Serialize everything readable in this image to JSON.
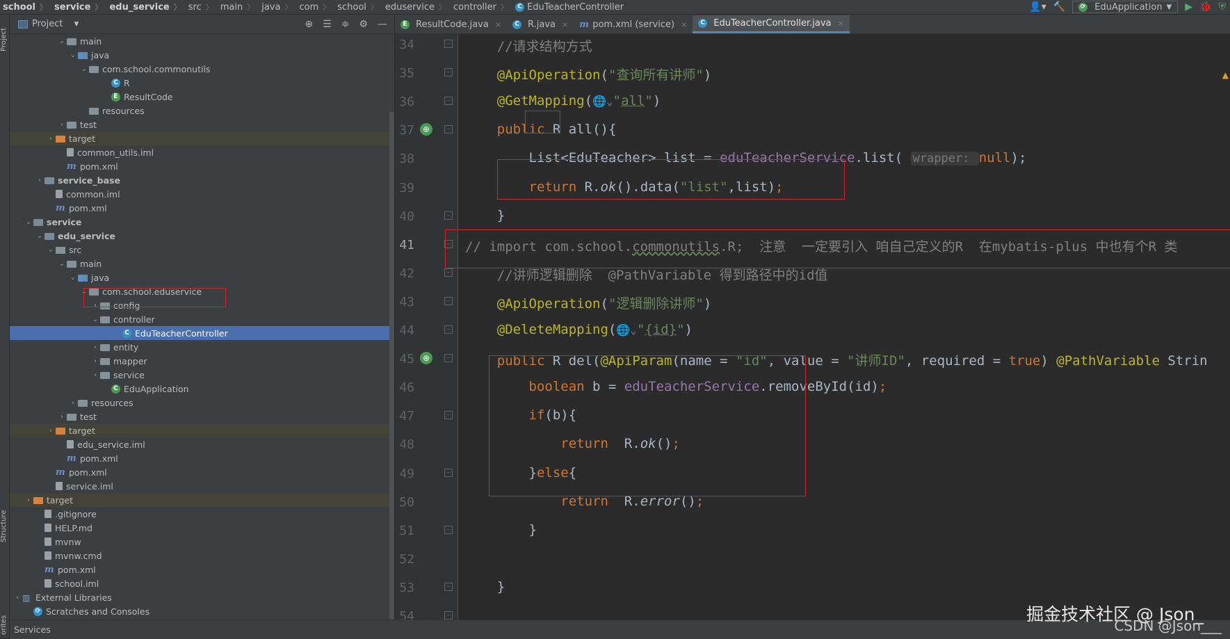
{
  "breadcrumb": [
    {
      "label": "school",
      "bold": true
    },
    {
      "label": "service",
      "bold": true
    },
    {
      "label": "edu_service",
      "bold": true
    },
    {
      "label": "src",
      "bold": false
    },
    {
      "label": "main",
      "bold": false
    },
    {
      "label": "java",
      "bold": false
    },
    {
      "label": "com",
      "bold": false
    },
    {
      "label": "school",
      "bold": false
    },
    {
      "label": "eduservice",
      "bold": false
    },
    {
      "label": "controller",
      "bold": false
    }
  ],
  "breadcrumb_current": "EduTeacherController",
  "run_config": "EduApplication",
  "left_tabs": {
    "project": "Project",
    "structure": "Structure",
    "favorites": "orites"
  },
  "project_panel": {
    "title": "Project"
  },
  "tree": [
    {
      "label": "main",
      "indent": 4,
      "icon": "folder",
      "arrow": "down"
    },
    {
      "label": "java",
      "indent": 5,
      "icon": "folder-blue",
      "arrow": "down"
    },
    {
      "label": "com.school.commonutils",
      "indent": 6,
      "icon": "package",
      "arrow": "down"
    },
    {
      "label": "R",
      "indent": 8,
      "icon": "class",
      "arrow": ""
    },
    {
      "label": "ResultCode",
      "indent": 8,
      "icon": "enum",
      "arrow": ""
    },
    {
      "label": "resources",
      "indent": 6,
      "icon": "folder-res",
      "arrow": ""
    },
    {
      "label": "test",
      "indent": 4,
      "icon": "folder",
      "arrow": "right"
    },
    {
      "label": "target",
      "indent": 3,
      "icon": "folder-orange",
      "arrow": "right",
      "highlight": "target"
    },
    {
      "label": "common_utils.iml",
      "indent": 4,
      "icon": "file",
      "arrow": ""
    },
    {
      "label": "pom.xml",
      "indent": 4,
      "icon": "maven",
      "arrow": ""
    },
    {
      "label": "service_base",
      "indent": 2,
      "icon": "module",
      "arrow": "right",
      "bold": true
    },
    {
      "label": "common.iml",
      "indent": 3,
      "icon": "file",
      "arrow": ""
    },
    {
      "label": "pom.xml",
      "indent": 3,
      "icon": "maven",
      "arrow": ""
    },
    {
      "label": "service",
      "indent": 1,
      "icon": "module",
      "arrow": "down",
      "bold": true
    },
    {
      "label": "edu_service",
      "indent": 2,
      "icon": "module",
      "arrow": "down",
      "bold": true
    },
    {
      "label": "src",
      "indent": 3,
      "icon": "folder",
      "arrow": "down"
    },
    {
      "label": "main",
      "indent": 4,
      "icon": "folder",
      "arrow": "down"
    },
    {
      "label": "java",
      "indent": 5,
      "icon": "folder-blue",
      "arrow": "down"
    },
    {
      "label": "com.school.eduservice",
      "indent": 6,
      "icon": "package",
      "arrow": "down"
    },
    {
      "label": "config",
      "indent": 7,
      "icon": "package",
      "arrow": "right"
    },
    {
      "label": "controller",
      "indent": 7,
      "icon": "package",
      "arrow": "down"
    },
    {
      "label": "EduTeacherController",
      "indent": 9,
      "icon": "class",
      "arrow": "",
      "highlight": "selected"
    },
    {
      "label": "entity",
      "indent": 7,
      "icon": "package",
      "arrow": "right"
    },
    {
      "label": "mapper",
      "indent": 7,
      "icon": "package",
      "arrow": "right"
    },
    {
      "label": "service",
      "indent": 7,
      "icon": "package",
      "arrow": "right"
    },
    {
      "label": "EduApplication",
      "indent": 8,
      "icon": "spring",
      "arrow": ""
    },
    {
      "label": "resources",
      "indent": 5,
      "icon": "folder-res",
      "arrow": "right"
    },
    {
      "label": "test",
      "indent": 4,
      "icon": "folder",
      "arrow": "right"
    },
    {
      "label": "target",
      "indent": 3,
      "icon": "folder-orange",
      "arrow": "right",
      "highlight": "target"
    },
    {
      "label": "edu_service.iml",
      "indent": 4,
      "icon": "file",
      "arrow": ""
    },
    {
      "label": "pom.xml",
      "indent": 4,
      "icon": "maven",
      "arrow": ""
    },
    {
      "label": "pom.xml",
      "indent": 3,
      "icon": "maven",
      "arrow": ""
    },
    {
      "label": "service.iml",
      "indent": 3,
      "icon": "file",
      "arrow": ""
    },
    {
      "label": "target",
      "indent": 1,
      "icon": "folder-orange",
      "arrow": "right",
      "highlight": "target"
    },
    {
      "label": ".gitignore",
      "indent": 2,
      "icon": "file",
      "arrow": ""
    },
    {
      "label": "HELP.md",
      "indent": 2,
      "icon": "file",
      "arrow": ""
    },
    {
      "label": "mvnw",
      "indent": 2,
      "icon": "file",
      "arrow": ""
    },
    {
      "label": "mvnw.cmd",
      "indent": 2,
      "icon": "file",
      "arrow": ""
    },
    {
      "label": "pom.xml",
      "indent": 2,
      "icon": "maven",
      "arrow": ""
    },
    {
      "label": "school.iml",
      "indent": 2,
      "icon": "file",
      "arrow": ""
    },
    {
      "label": "External Libraries",
      "indent": 0,
      "icon": "libs",
      "arrow": "right"
    },
    {
      "label": "Scratches and Consoles",
      "indent": 1,
      "icon": "scratch",
      "arrow": ""
    }
  ],
  "services_label": "Services",
  "tabs": [
    {
      "label": "ResultCode.java",
      "icon": "enum",
      "active": false
    },
    {
      "label": "R.java",
      "icon": "class",
      "active": false
    },
    {
      "label": "pom.xml (service)",
      "icon": "maven",
      "active": false
    },
    {
      "label": "EduTeacherController.java",
      "icon": "class",
      "active": true
    }
  ],
  "code_lines": [
    {
      "n": "34",
      "indent": "    ",
      "tokens": [
        {
          "t": "//请求结构方式",
          "c": "cmt"
        }
      ]
    },
    {
      "n": "35",
      "indent": "    ",
      "tokens": [
        {
          "t": "@ApiOperation",
          "c": "ann"
        },
        {
          "t": "(",
          "c": ""
        },
        {
          "t": "\"查询所有讲师\"",
          "c": "str"
        },
        {
          "t": ")",
          "c": ""
        }
      ]
    },
    {
      "n": "36",
      "indent": "    ",
      "tokens": [
        {
          "t": "@GetMapping",
          "c": "ann"
        },
        {
          "t": "(",
          "c": ""
        },
        {
          "t": "🌐⌄",
          "c": "globe"
        },
        {
          "t": "\"",
          "c": "str"
        },
        {
          "t": "all",
          "c": "str ul"
        },
        {
          "t": "\"",
          "c": "str"
        },
        {
          "t": ")",
          "c": ""
        }
      ]
    },
    {
      "n": "37",
      "indent": "    ",
      "tokens": [
        {
          "t": "public",
          "c": "kw"
        },
        {
          "t": " R ",
          "c": ""
        },
        {
          "t": "all",
          "c": ""
        },
        {
          "t": "(){",
          "c": ""
        }
      ],
      "gutter": true
    },
    {
      "n": "38",
      "indent": "        ",
      "tokens": [
        {
          "t": "List<EduTeacher> list = ",
          "c": ""
        },
        {
          "t": "eduTeacherService",
          "c": "fld"
        },
        {
          "t": ".list( ",
          "c": ""
        },
        {
          "t": "wrapper: ",
          "c": "hint"
        },
        {
          "t": "null",
          "c": "kw"
        },
        {
          "t": ");",
          "c": ""
        }
      ]
    },
    {
      "n": "39",
      "indent": "        ",
      "tokens": [
        {
          "t": "return",
          "c": "kw"
        },
        {
          "t": " R.",
          "c": ""
        },
        {
          "t": "ok",
          "c": "it"
        },
        {
          "t": "().data(",
          "c": ""
        },
        {
          "t": "\"list\"",
          "c": "str"
        },
        {
          "t": ",list)",
          "c": ""
        },
        {
          "t": ";",
          "c": "kw"
        }
      ]
    },
    {
      "n": "40",
      "indent": "    ",
      "tokens": [
        {
          "t": "}",
          "c": ""
        }
      ]
    },
    {
      "n": "41",
      "indent": "",
      "tokens": [
        {
          "t": "// import com.school.",
          "c": "cmt"
        },
        {
          "t": "commonutils",
          "c": "cmt wavy"
        },
        {
          "t": ".R;  注意  一定要引入 咱自己定义的R  在mybatis-plus 中也有个R 类",
          "c": "cmt"
        }
      ],
      "current": true
    },
    {
      "n": "42",
      "indent": "    ",
      "tokens": [
        {
          "t": "//讲师逻辑删除  @PathVariable 得到路径中的id值",
          "c": "cmt"
        }
      ]
    },
    {
      "n": "43",
      "indent": "    ",
      "tokens": [
        {
          "t": "@ApiOperation",
          "c": "ann"
        },
        {
          "t": "(",
          "c": ""
        },
        {
          "t": "\"逻辑删除讲师\"",
          "c": "str"
        },
        {
          "t": ")",
          "c": ""
        }
      ]
    },
    {
      "n": "44",
      "indent": "    ",
      "tokens": [
        {
          "t": "@DeleteMapping",
          "c": "ann"
        },
        {
          "t": "(",
          "c": ""
        },
        {
          "t": "🌐⌄",
          "c": "globe"
        },
        {
          "t": "\"",
          "c": "str"
        },
        {
          "t": "{id}",
          "c": "str ul"
        },
        {
          "t": "\"",
          "c": "str"
        },
        {
          "t": ")",
          "c": ""
        }
      ]
    },
    {
      "n": "45",
      "indent": "    ",
      "tokens": [
        {
          "t": "public",
          "c": "kw"
        },
        {
          "t": " R del(",
          "c": ""
        },
        {
          "t": "@ApiParam",
          "c": "ann"
        },
        {
          "t": "(name = ",
          "c": ""
        },
        {
          "t": "\"id\"",
          "c": "str"
        },
        {
          "t": ", value = ",
          "c": ""
        },
        {
          "t": "\"讲师ID\"",
          "c": "str"
        },
        {
          "t": ", required = ",
          "c": ""
        },
        {
          "t": "true",
          "c": "kw"
        },
        {
          "t": ") ",
          "c": ""
        },
        {
          "t": "@PathVariable",
          "c": "ann"
        },
        {
          "t": " Strin",
          "c": ""
        }
      ],
      "gutter": true
    },
    {
      "n": "46",
      "indent": "        ",
      "tokens": [
        {
          "t": "boolean",
          "c": "kw"
        },
        {
          "t": " b = ",
          "c": ""
        },
        {
          "t": "eduTeacherService",
          "c": "fld"
        },
        {
          "t": ".removeById(id)",
          "c": ""
        },
        {
          "t": ";",
          "c": "kw"
        }
      ]
    },
    {
      "n": "47",
      "indent": "        ",
      "tokens": [
        {
          "t": "if",
          "c": "kw"
        },
        {
          "t": "(b){",
          "c": ""
        }
      ]
    },
    {
      "n": "48",
      "indent": "            ",
      "tokens": [
        {
          "t": "return",
          "c": "kw"
        },
        {
          "t": "  R.",
          "c": ""
        },
        {
          "t": "ok",
          "c": "it"
        },
        {
          "t": "()",
          "c": ""
        },
        {
          "t": ";",
          "c": "kw"
        }
      ]
    },
    {
      "n": "49",
      "indent": "        ",
      "tokens": [
        {
          "t": "}",
          "c": ""
        },
        {
          "t": "else",
          "c": "kw"
        },
        {
          "t": "{",
          "c": ""
        }
      ]
    },
    {
      "n": "50",
      "indent": "            ",
      "tokens": [
        {
          "t": "return",
          "c": "kw"
        },
        {
          "t": "  R.",
          "c": ""
        },
        {
          "t": "error",
          "c": "it"
        },
        {
          "t": "()",
          "c": ""
        },
        {
          "t": ";",
          "c": "kw"
        }
      ]
    },
    {
      "n": "51",
      "indent": "        ",
      "tokens": [
        {
          "t": "}",
          "c": ""
        }
      ]
    },
    {
      "n": "52",
      "indent": "",
      "tokens": []
    },
    {
      "n": "53",
      "indent": "    ",
      "tokens": [
        {
          "t": "}",
          "c": ""
        }
      ]
    },
    {
      "n": "54",
      "indent": "",
      "tokens": []
    }
  ],
  "watermark": {
    "line1": "掘金技术社区 @ Json_",
    "line2": "CSDN @Json___"
  },
  "colors": {
    "accent": "#4a88c7",
    "selection": "#4b6eaf",
    "annotation_box": "#d6202a"
  }
}
